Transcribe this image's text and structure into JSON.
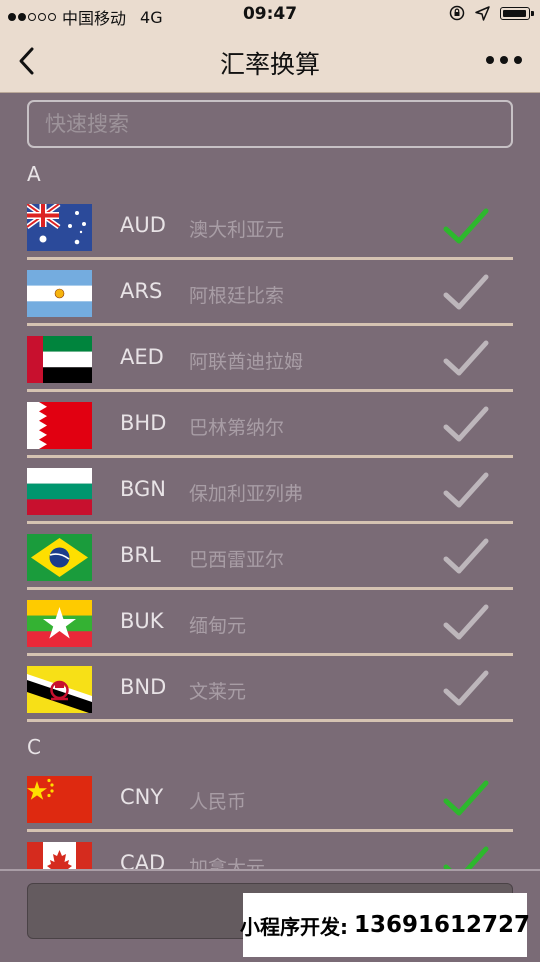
{
  "status_bar": {
    "carrier": "中国移动",
    "network": "4G",
    "time": "09:47",
    "signal_bars_filled": 2,
    "signal_bars_total": 5
  },
  "nav": {
    "title": "汇率换算",
    "back_icon": "chevron-left-icon",
    "more_icon": "more-dots-icon"
  },
  "search": {
    "placeholder": "快速搜索",
    "value": ""
  },
  "sections": [
    {
      "letter": "A",
      "items": [
        {
          "code": "AUD",
          "name": "澳大利亚元",
          "selected": true
        },
        {
          "code": "ARS",
          "name": "阿根廷比索",
          "selected": false
        },
        {
          "code": "AED",
          "name": "阿联酋迪拉姆",
          "selected": false
        },
        {
          "code": "BHD",
          "name": "巴林第纳尔",
          "selected": false
        },
        {
          "code": "BGN",
          "name": "保加利亚列弗",
          "selected": false
        },
        {
          "code": "BRL",
          "name": "巴西雷亚尔",
          "selected": false
        },
        {
          "code": "BUK",
          "name": "缅甸元",
          "selected": false
        },
        {
          "code": "BND",
          "name": "文莱元",
          "selected": false
        }
      ]
    },
    {
      "letter": "C",
      "items": [
        {
          "code": "CNY",
          "name": "人民币",
          "selected": true
        },
        {
          "code": "CAD",
          "name": "加拿大元",
          "selected": true
        }
      ]
    }
  ],
  "watermark": {
    "label": "小程序开发:",
    "phone": "13691612727"
  },
  "colors": {
    "header_bg": "#eadccf",
    "page_bg": "#7a6b76",
    "check_selected": "#2db82d",
    "check_unselected": "#bdb6bb"
  }
}
